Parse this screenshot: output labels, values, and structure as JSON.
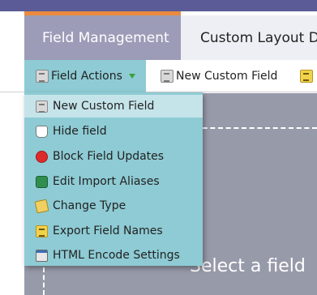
{
  "tabs": {
    "field_management": "Field Management",
    "custom_layout": "Custom Layout De"
  },
  "toolbar": {
    "field_actions_label": "Field Actions",
    "new_custom_field_label": "New Custom Field"
  },
  "menu": {
    "items": [
      {
        "label": "New Custom Field",
        "icon": "document-icon"
      },
      {
        "label": "Hide field",
        "icon": "flask-icon"
      },
      {
        "label": "Block Field Updates",
        "icon": "block-icon"
      },
      {
        "label": "Edit Import Aliases",
        "icon": "edit-aliases-icon"
      },
      {
        "label": "Change Type",
        "icon": "change-type-icon"
      },
      {
        "label": "Export Field Names",
        "icon": "export-icon"
      },
      {
        "label": "HTML Encode Settings",
        "icon": "html-window-icon"
      }
    ]
  },
  "canvas": {
    "hint": "Select a field"
  },
  "colors": {
    "top_bar": "#5a5b97",
    "tab_accent": "#e98a3d",
    "active_tab": "#9c9cb8",
    "menu_bg": "#8ecbd4",
    "menu_highlight": "#c5e4ea",
    "canvas": "#979aa9"
  }
}
